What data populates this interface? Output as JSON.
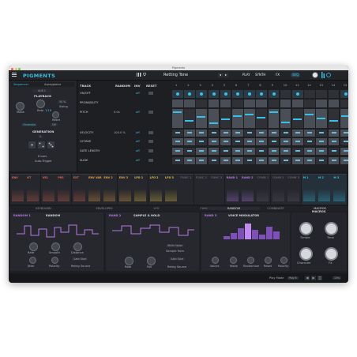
{
  "window": {
    "title": "Pigments"
  },
  "topbar": {
    "brand": "PIGMENTS",
    "preset_name": "Retting Tone",
    "preset_prev": "◂",
    "preset_next": "▸",
    "play_label": "PLAY",
    "synth_label": "SYNTH",
    "fx_label": "FX",
    "seq_label": "SEQ"
  },
  "left_panel": {
    "mode_tabs": [
      "Sequencer",
      "Arpeggiator"
    ],
    "aux_label": "AUX 1",
    "playback_header": "PLAYBACK",
    "mode_label": "Mode",
    "rate_label": "Rate",
    "rate_value": "1/16",
    "swing_label": "Swing",
    "swing_value": "50 %",
    "reset_label": "Reset",
    "reset_mode": "Off",
    "source_value": "Chromatic",
    "generation_header": "GENERATION",
    "gen_value": "1",
    "auto_trigger_value": "8 bars",
    "auto_trigger_label": "Auto-Trigger"
  },
  "sequencer": {
    "track_header": "TRACK",
    "random_header": "RANDOM",
    "inv_header": "INV",
    "reset_header": "RESET",
    "steps": [
      "1",
      "2",
      "3",
      "4",
      "5",
      "6",
      "7",
      "8",
      "9",
      "10",
      "11",
      "12",
      "13",
      "14",
      "15",
      "16"
    ],
    "rows": [
      {
        "name": "ON/OFF",
        "random": "",
        "inv": "off"
      },
      {
        "name": "PROBABILITY",
        "random": "",
        "inv": ""
      },
      {
        "name": "PITCH",
        "random": "0.0s",
        "inv": "off"
      },
      {
        "name": "VELOCITY",
        "random": "100.0 %",
        "inv": "off"
      },
      {
        "name": "OCTAVE",
        "random": "",
        "inv": "off"
      },
      {
        "name": "GATE LENGTH",
        "random": "",
        "inv": "off"
      },
      {
        "name": "SLIDE",
        "random": "",
        "inv": "off"
      }
    ],
    "pitch_values": [
      "+12",
      "+5",
      "+7",
      "0",
      "+3",
      "+5",
      "+7",
      "+9"
    ]
  },
  "mod_tabs": [
    {
      "label": "ENV",
      "color": "#e0654d"
    },
    {
      "label": "KT",
      "color": "#e0654d"
    },
    {
      "label": "VEL",
      "color": "#e0654d"
    },
    {
      "label": "PRS",
      "color": "#e0654d"
    },
    {
      "label": "EXT",
      "color": "#e0654d"
    },
    {
      "label": "ENV VAR",
      "color": "#e7a33d"
    },
    {
      "label": "ENV 2",
      "color": "#e7a33d"
    },
    {
      "label": "ENV 3",
      "color": "#e7a33d"
    },
    {
      "label": "LFO 1",
      "color": "#e8c63e"
    },
    {
      "label": "LFO 2",
      "color": "#e8c63e"
    },
    {
      "label": "LFO 3",
      "color": "#e8c63e"
    },
    {
      "label": "FUNC 1",
      "color": "#5a5d66"
    },
    {
      "label": "FUNC 2",
      "color": "#5a5d66"
    },
    {
      "label": "FUNC 3",
      "color": "#5a5d66"
    },
    {
      "label": "RAND 1",
      "color": "#b477e8"
    },
    {
      "label": "RAND 2",
      "color": "#b477e8"
    },
    {
      "label": "COMB 1",
      "color": "#5a5d66"
    },
    {
      "label": "COMB 2",
      "color": "#5a5d66"
    },
    {
      "label": "COMB 3",
      "color": "#5a5d66"
    },
    {
      "label": "M 1",
      "color": "#38c1e6"
    },
    {
      "label": "M 2",
      "color": "#38c1e6"
    },
    {
      "label": "M 3",
      "color": "#38c1e6"
    }
  ],
  "categories": [
    "KEYBOARD",
    "ENVELOPES",
    "LFO",
    "FUNCTIONS",
    "RANDOM",
    "COMBINATE",
    "MACROS"
  ],
  "random_panel": {
    "tabs": [
      "RANDOM 1",
      "RANDOM",
      "RAND 2",
      "SAMPLE & HOLD",
      "RAND 3",
      "VOICE MODULATOR"
    ],
    "knobs1": [
      "Rate",
      "Smooth",
      "Distance"
    ],
    "knobs2": [
      "Jitter",
      "Polarity",
      "Retrig Source"
    ],
    "retrig_value": "Gate Start",
    "sh_knobs": [
      "Rate",
      "Fall",
      "Retrig Source"
    ],
    "sh_sample_from": "Sample from",
    "sh_value": "White Noise",
    "sh_retrig_value": "Gate Start",
    "vm_knobs": [
      "Voices",
      "Mode",
      "Randomize",
      "Reset",
      "Polarity"
    ]
  },
  "macros": {
    "header": "MACROS",
    "knobs": [
      "Timbre",
      "Time",
      "Character",
      "FX"
    ]
  },
  "status": {
    "play_mode_label": "Play Mode",
    "play_mode_value": "Poly 8",
    "zoom": "13%"
  },
  "colors": {
    "accent": "#38c1e6",
    "purple": "#b477e8",
    "yellow": "#e8c63e"
  }
}
